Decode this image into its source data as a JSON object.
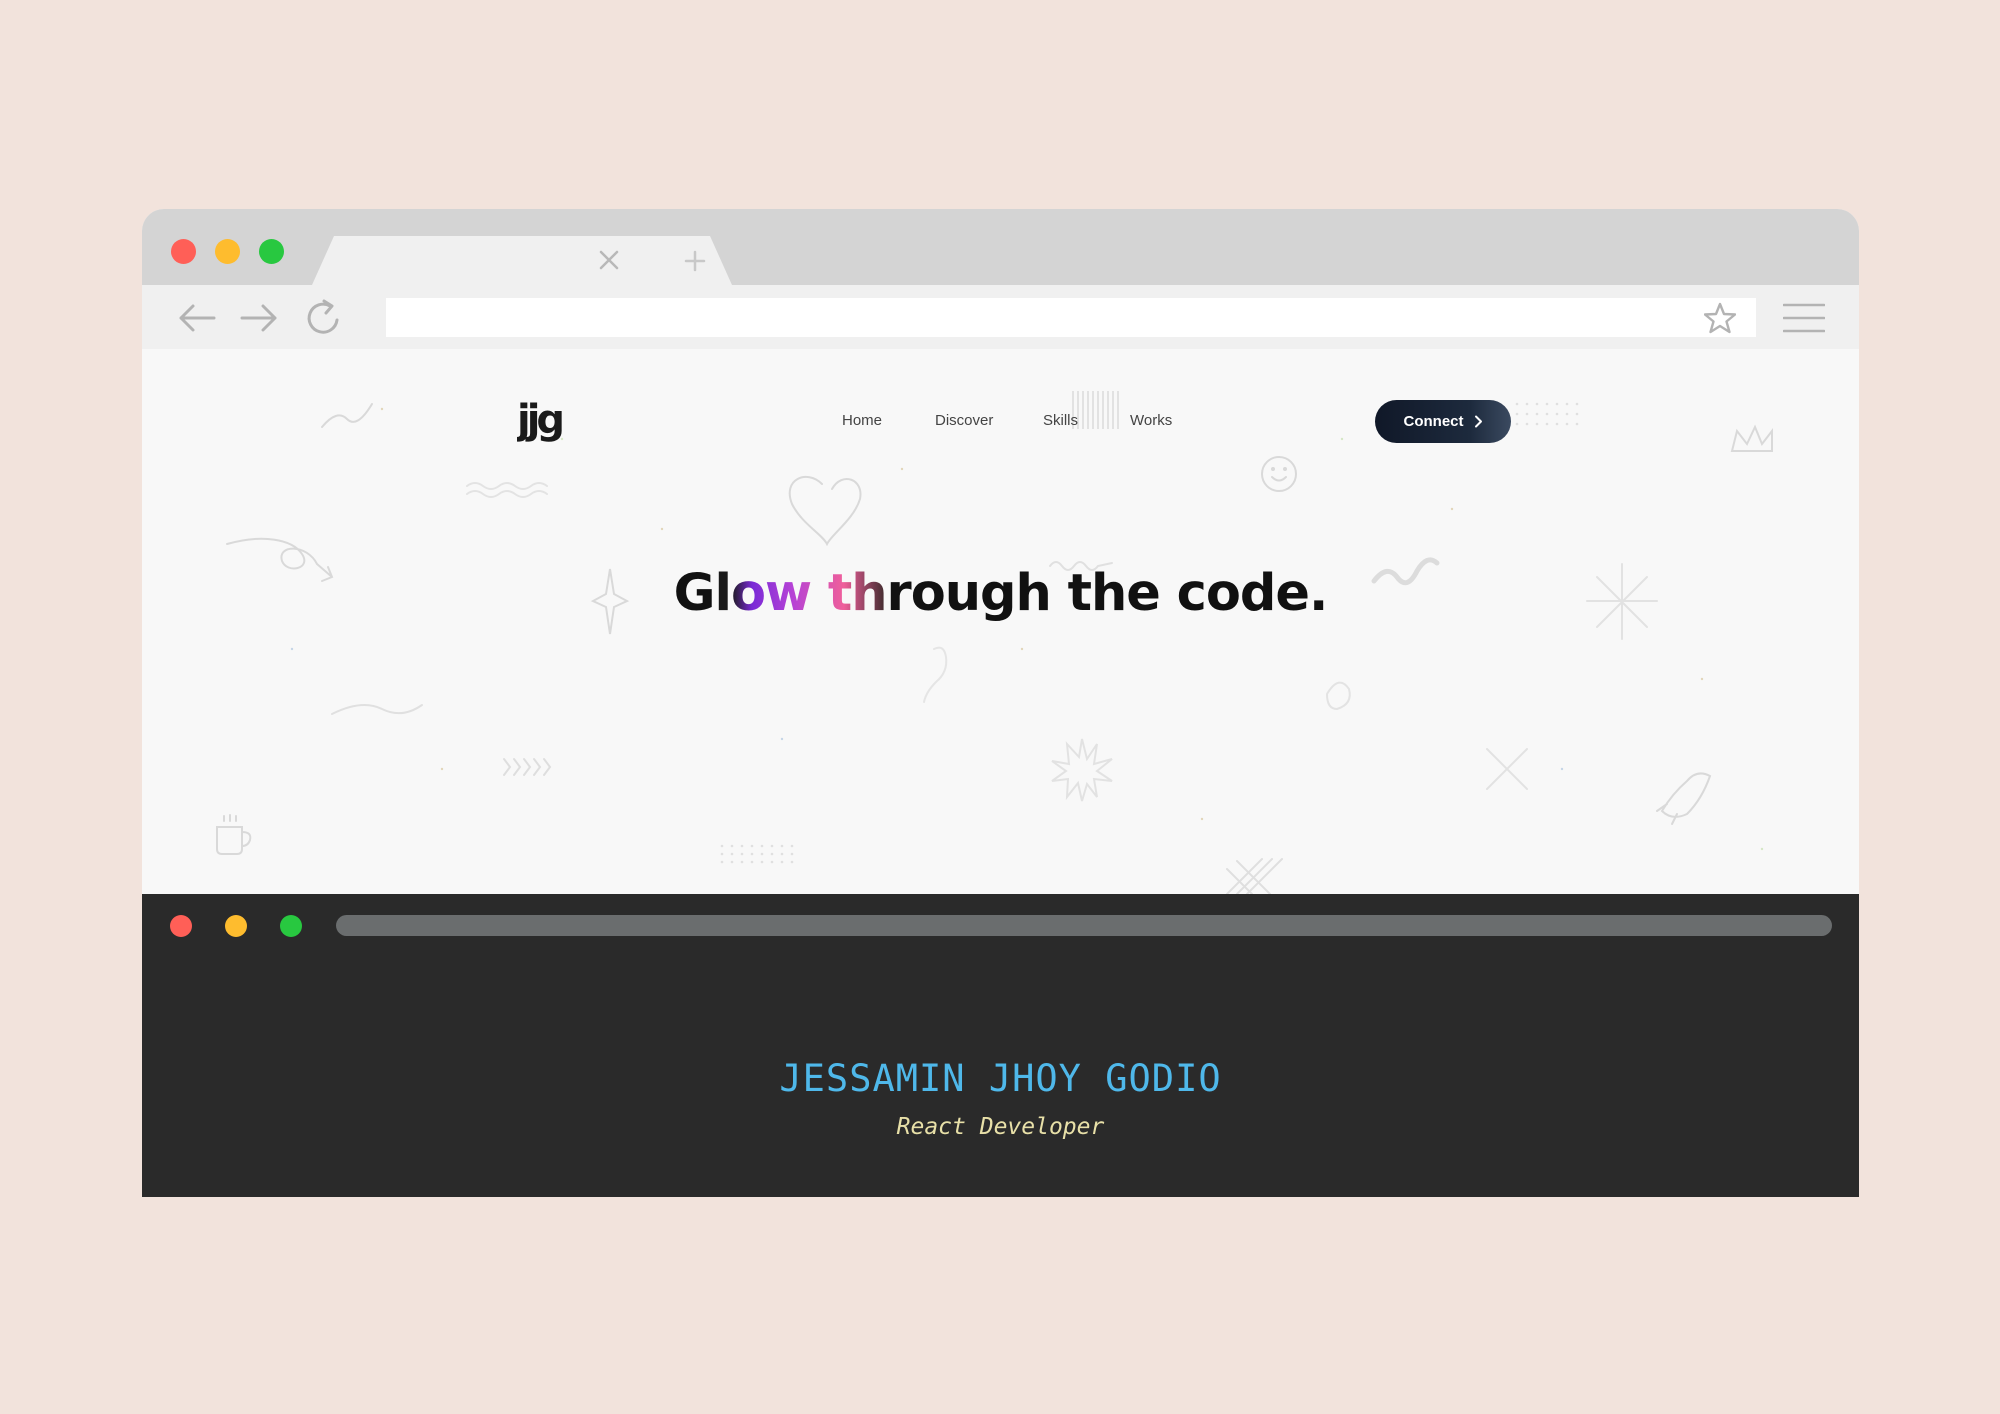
{
  "colors": {
    "page_background": "#f2e3dc",
    "traffic_red": "#ff5f57",
    "traffic_yellow": "#febc2e",
    "traffic_green": "#28c840",
    "terminal_background": "#2a2a2a",
    "terminal_name": "#4fb8ea",
    "terminal_role": "#e8e0a8",
    "connect_button": "#101828"
  },
  "browser": {
    "address_bar": {
      "value": "",
      "placeholder": ""
    },
    "icons": {
      "back": "arrow-left-icon",
      "forward": "arrow-right-icon",
      "reload": "reload-icon",
      "bookmark": "star-icon",
      "menu": "hamburger-menu-icon",
      "tab_close": "close-icon",
      "new_tab": "plus-icon"
    }
  },
  "site": {
    "logo_text": "jjg",
    "nav": [
      {
        "label": "Home"
      },
      {
        "label": "Discover"
      },
      {
        "label": "Skills"
      },
      {
        "label": "Works"
      }
    ],
    "connect_label": "Connect",
    "hero": {
      "prefix": "G",
      "glow": "low th",
      "suffix": "rough the code."
    }
  },
  "terminal": {
    "name": "JESSAMIN JHOY GODIO",
    "role": "React Developer"
  }
}
